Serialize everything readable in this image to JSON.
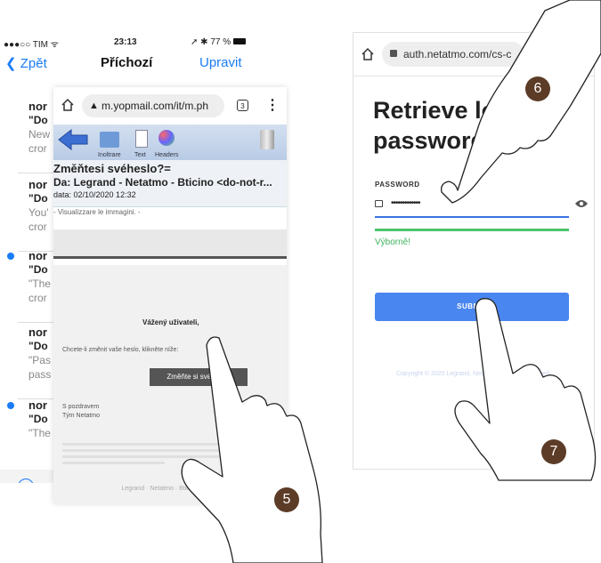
{
  "left_phone": {
    "status": {
      "carrier": "●●●○○ TIM ᯤ",
      "time": "23:13",
      "battery": "➚ ✱ 77 %"
    },
    "nav": {
      "back": "Zpět",
      "title": "Příchozí",
      "edit": "Upravit"
    },
    "items": [
      {
        "sender": "nor",
        "subject": "\"Do",
        "line1": "New",
        "line2": "cror",
        "unread": false
      },
      {
        "sender": "nor",
        "subject": "\"Do",
        "line1": "You'",
        "line2": "cror",
        "unread": false
      },
      {
        "sender": "nor",
        "subject": "\"Do",
        "line1": "\"The",
        "line2": "cror",
        "unread": true
      },
      {
        "sender": "nor",
        "subject": "\"Do",
        "line1": "\"Pas",
        "line2": "pass",
        "unread": false
      },
      {
        "sender": "nor",
        "subject": "\"Do",
        "line1": "\"The",
        "line2": "",
        "unread": true
      }
    ]
  },
  "yopmail": {
    "url": "m.yopmail.com/it/m.ph",
    "toolbar": {
      "inbox": "Inoltrare",
      "text": "Text",
      "headers": "Headers"
    },
    "subject": "Změňtesi svéheslo?=",
    "from": "Da: Legrand - Netatmo - Bticino <do-not-r...",
    "date": "data: 02/10/2020 12:32",
    "images_note": "- Visualizzare le immagini. -",
    "greeting": "Vážený uživateli,",
    "ask": "Chcete-li změnit vaše heslo, klikněte níže:",
    "button": "Změňte si své heslo",
    "regards1": "S pozdravem",
    "regards2": "Tým Netatmo",
    "footer": "Legrand · Netatmo · Bticino, Všech"
  },
  "netatmo": {
    "url": "auth.netatmo.com/cs-c",
    "title_line1": "Retrieve lost",
    "title_line2": "password",
    "password_label": "PASSWORD",
    "password_value": "•••••••••••••",
    "strength_text": "Výborně!",
    "submit": "SUBMIT",
    "copyright": "Copyright © 2020 Legrand, Netatmo. All rights reserved."
  },
  "steps": {
    "five": "5",
    "six": "6",
    "seven": "7"
  },
  "colors": {
    "ios_blue": "#1a7cf5",
    "submit_blue": "#4a86ef",
    "strength_green": "#4bc56b",
    "badge_brown": "#5c3c27"
  },
  "icons": [
    "home-icon",
    "lock-icon",
    "tab-count-icon",
    "more-vert-icon",
    "back-arrow-icon",
    "trash-icon",
    "eye-icon",
    "warning-icon"
  ]
}
